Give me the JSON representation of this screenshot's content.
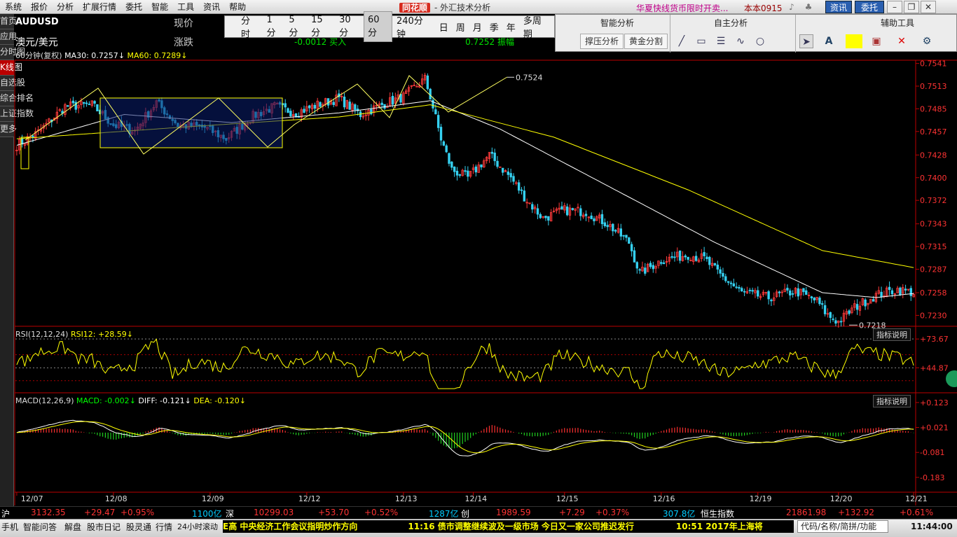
{
  "menubar": {
    "items": [
      "系统",
      "报价",
      "分析",
      "扩展行情",
      "委托",
      "智能",
      "工具",
      "资讯",
      "帮助"
    ],
    "center_logo": "同花顺",
    "center_title": "- 外汇技术分析",
    "promo": "华夏快线货币限时开卖...",
    "version": "本本0915",
    "btn_news": "资讯",
    "btn_trade": "委托"
  },
  "sidebar": {
    "tabs": [
      "首页",
      "应用",
      "分时图",
      "K线图",
      "自选股",
      "综合排名",
      "上证指数",
      "更多"
    ]
  },
  "header": {
    "symbol": "AUDUSD",
    "name": "澳元/美元",
    "label_price": "现价",
    "label_change": "涨跌",
    "ticker": [
      "-0.0012 买入",
      "0.7252 振幅"
    ]
  },
  "timeframes": [
    "分时",
    "1分",
    "5分",
    "15分",
    "30分",
    "60分",
    "240分钟",
    "日",
    "周",
    "月",
    "季",
    "年",
    "多周期"
  ],
  "selected_timeframe": "60分",
  "toolpanel": {
    "sec1_title": "智能分析",
    "sec2_title": "自主分析",
    "sec3_title": "辅助工具",
    "btn_support": "撑压分析",
    "btn_golden": "黄金分割"
  },
  "main_legend": {
    "period": "60分钟(复权)",
    "ma30": "MA30: 0.7257",
    "ma60": "MA60: 0.7289"
  },
  "rsi_legend": {
    "label": "RSI(12,12,24)",
    "rsi12": "RSI12: +28.59"
  },
  "macd_legend": {
    "label": "MACD(12,26,9)",
    "macd": "MACD: -0.002",
    "diff": "DIFF: -0.121",
    "dea": "DEA: -0.120"
  },
  "indicator_explain": "指标说明",
  "high_label": "0.7524",
  "low_label": "0.7218",
  "status": {
    "sh": "沪",
    "sh_val": "3132.35",
    "sh_chg": "+29.47",
    "sh_pct": "+0.95%",
    "sh_amt": "1100亿",
    "sz": "深",
    "sz_val": "10299.03",
    "sz_chg": "+53.70",
    "sz_pct": "+0.52%",
    "sz_amt": "1287亿",
    "cy": "创",
    "cy_val": "1989.59",
    "cy_chg": "+7.29",
    "cy_pct": "+0.37%",
    "cy_amt": "307.8亿",
    "hs": "恒生指数",
    "hs_val": "21861.98",
    "hs_chg": "+132.92",
    "hs_pct": "+0.61%"
  },
  "bottombar": {
    "items": [
      "手机",
      "智能问答",
      "解盘",
      "股市日记",
      "股灵通",
      "行情",
      "24小时滚动"
    ],
    "news": "E高 中央经济工作会议指明炒作方向　　　　　　11:16 债市调整继续波及一级市场 今日又一家公司推迟发行　　　　　10:51 2017年上海将",
    "search_placeholder": "代码/名称/简拼/功能",
    "clock": "11:44:00"
  },
  "chart_data": {
    "type": "candlestick",
    "main": {
      "yticks": [
        "0.7541",
        "0.7513",
        "0.7485",
        "0.7457",
        "0.7428",
        "0.7400",
        "0.7372",
        "0.7343",
        "0.7315",
        "0.7287",
        "0.7258",
        "0.7230"
      ],
      "ylim": [
        0.722,
        0.7545
      ],
      "xticks": [
        "12/07",
        "12/08",
        "12/09",
        "12/12",
        "12/13",
        "12/14",
        "12/15",
        "12/16",
        "12/19",
        "12/20",
        "12/21"
      ],
      "close_anchor": [
        [
          0,
          0.744
        ],
        [
          8,
          0.7456
        ],
        [
          18,
          0.7488
        ],
        [
          28,
          0.749
        ],
        [
          36,
          0.7465
        ],
        [
          44,
          0.7458
        ],
        [
          52,
          0.7493
        ],
        [
          60,
          0.7465
        ],
        [
          70,
          0.7462
        ],
        [
          78,
          0.7448
        ],
        [
          88,
          0.7476
        ],
        [
          96,
          0.7488
        ],
        [
          104,
          0.748
        ],
        [
          112,
          0.749
        ],
        [
          120,
          0.7498
        ],
        [
          128,
          0.7478
        ],
        [
          136,
          0.749
        ],
        [
          144,
          0.75
        ],
        [
          152,
          0.7522
        ],
        [
          154,
          0.75
        ],
        [
          158,
          0.7448
        ],
        [
          162,
          0.741
        ],
        [
          168,
          0.74
        ],
        [
          176,
          0.7428
        ],
        [
          184,
          0.74
        ],
        [
          190,
          0.7372
        ],
        [
          196,
          0.735
        ],
        [
          204,
          0.736
        ],
        [
          212,
          0.7358
        ],
        [
          220,
          0.7343
        ],
        [
          228,
          0.732
        ],
        [
          232,
          0.7282
        ],
        [
          240,
          0.7298
        ],
        [
          250,
          0.7305
        ],
        [
          256,
          0.73
        ],
        [
          262,
          0.728
        ],
        [
          270,
          0.7258
        ],
        [
          280,
          0.7252
        ],
        [
          290,
          0.726
        ],
        [
          298,
          0.7248
        ],
        [
          302,
          0.723
        ],
        [
          306,
          0.7222
        ],
        [
          312,
          0.724
        ],
        [
          320,
          0.7255
        ],
        [
          328,
          0.7262
        ],
        [
          334,
          0.7258
        ]
      ],
      "ma30_anchor": [
        [
          0,
          0.744
        ],
        [
          40,
          0.7478
        ],
        [
          80,
          0.7468
        ],
        [
          120,
          0.748
        ],
        [
          154,
          0.7495
        ],
        [
          180,
          0.746
        ],
        [
          220,
          0.739
        ],
        [
          260,
          0.732
        ],
        [
          300,
          0.7258
        ],
        [
          320,
          0.7252
        ],
        [
          334,
          0.7257
        ]
      ],
      "ma60_anchor": [
        [
          0,
          0.7448
        ],
        [
          60,
          0.7462
        ],
        [
          120,
          0.7475
        ],
        [
          154,
          0.749
        ],
        [
          200,
          0.745
        ],
        [
          250,
          0.7385
        ],
        [
          300,
          0.731
        ],
        [
          334,
          0.7289
        ]
      ]
    },
    "rsi": {
      "yticks": [
        "+73.67",
        "+44.87"
      ],
      "ylim": [
        22,
        85
      ]
    },
    "macd": {
      "yticks": [
        "+0.123",
        "+0.021",
        "-0.081",
        "-0.183"
      ],
      "ylim": [
        -0.235,
        0.16
      ]
    }
  }
}
